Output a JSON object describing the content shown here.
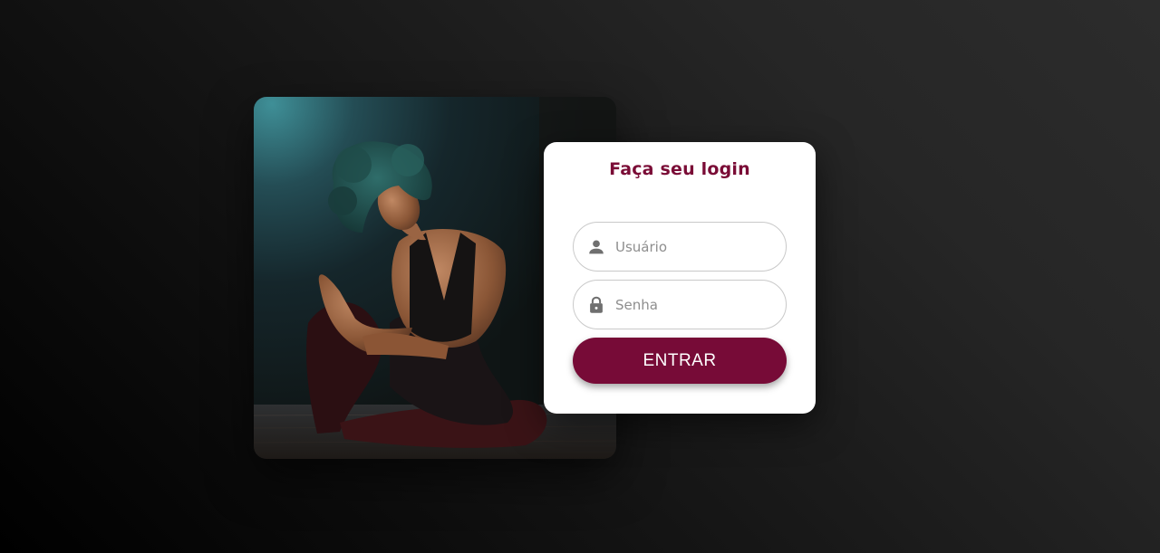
{
  "login": {
    "title": "Faça seu login",
    "username": {
      "placeholder": "Usuário",
      "value": "",
      "icon": "user-icon"
    },
    "password": {
      "placeholder": "Senha",
      "value": "",
      "icon": "lock-icon"
    },
    "submit_label": "ENTRAR"
  },
  "colors": {
    "accent": "#770b37",
    "title": "#7a0c36",
    "card": "#ffffff",
    "icon": "#6f6f6f"
  },
  "photo": {
    "subject": "dancer-photo"
  }
}
